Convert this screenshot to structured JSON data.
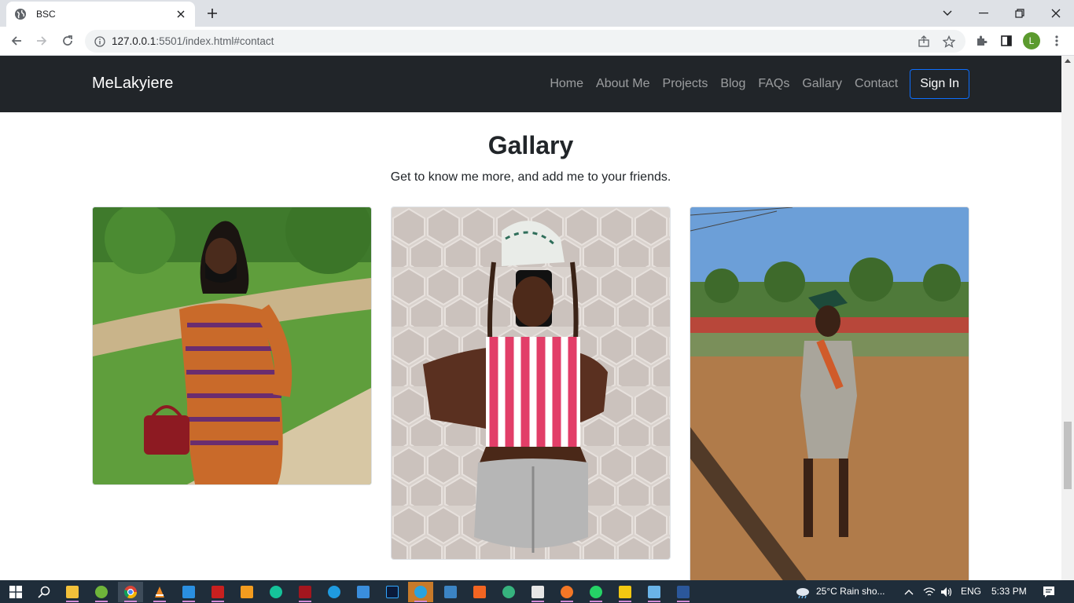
{
  "browser": {
    "tab_title": "BSC",
    "url_host": "127.0.0.1",
    "url_rest": ":5501/index.html#contact",
    "profile_initial": "L"
  },
  "site": {
    "brand": "MeLakyiere",
    "nav": [
      "Home",
      "About Me",
      "Projects",
      "Blog",
      "FAQs",
      "Gallary",
      "Contact"
    ],
    "signin_label": "Sign In"
  },
  "gallery": {
    "title": "Gallary",
    "subtitle": "Get to know me more, and add me to your friends."
  },
  "taskbar": {
    "weather": "25°C  Rain sho...",
    "language": "ENG",
    "time": "5:33 PM"
  },
  "colors": {
    "navbar_bg": "#212529",
    "signin_border": "#0d6efd",
    "taskbar_bg": "#1f2d3a"
  }
}
